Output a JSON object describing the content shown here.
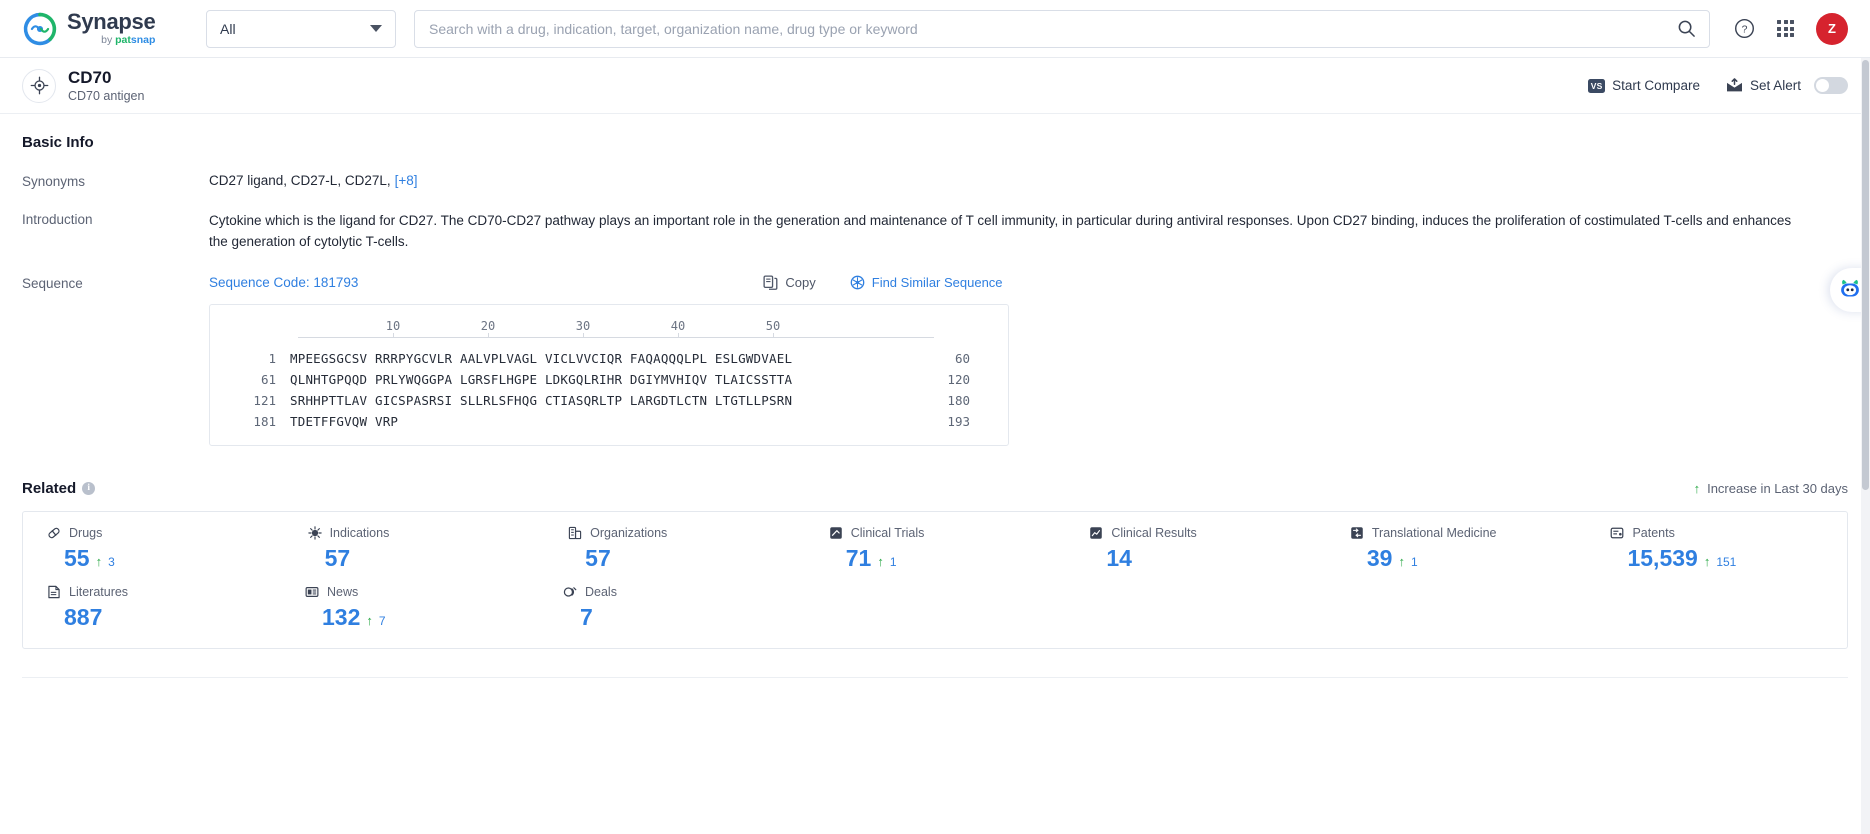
{
  "header": {
    "brand_name": "Synapse",
    "brand_by": "by",
    "brand_pat": "pat",
    "brand_snap": "snap",
    "category_select": "All",
    "search_placeholder": "Search with a drug, indication, target, organization name, drug type or keyword",
    "help_icon": "question-mark-circle-icon",
    "apps_icon": "app-grid-icon",
    "avatar_initial": "Z"
  },
  "entity": {
    "name": "CD70",
    "subtitle": "CD70 antigen",
    "start_compare": "Start Compare",
    "compare_badge": "VS",
    "set_alert": "Set Alert",
    "alert_toggle_state": "off"
  },
  "basic_info": {
    "title": "Basic Info",
    "synonyms_label": "Synonyms",
    "synonyms_value": "CD27 ligand,  CD27-L,  CD27L,",
    "synonyms_more": "[+8]",
    "introduction_label": "Introduction",
    "introduction_value": "Cytokine which is the ligand for CD27. The CD70-CD27 pathway plays an important role in the generation and maintenance of T cell immunity, in particular during antiviral responses. Upon CD27 binding, induces the proliferation of costimulated T-cells and enhances the generation of cytolytic T-cells.",
    "sequence_label": "Sequence",
    "sequence_code": "Sequence Code: 181793",
    "copy_label": "Copy",
    "find_similar_label": "Find Similar Sequence"
  },
  "sequence": {
    "ruler": [
      "10",
      "20",
      "30",
      "40",
      "50"
    ],
    "lines": [
      {
        "start": "1",
        "residues": "MPEEGSGCSV RRRPYGCVLR AALVPLVAGL VICLVVCIQR FAQAQQQLPL ESLGWDVAEL",
        "end": "60"
      },
      {
        "start": "61",
        "residues": "QLNHTGPQQD PRLYWQGGPA LGRSFLHGPE LDKGQLRIHR DGIYMVHIQV TLAICSSTTA",
        "end": "120"
      },
      {
        "start": "121",
        "residues": "SRHHPTTLAV GICSPASRSI SLLRLSFHQG CTIASQRLTP LARGDTLCTN LTGTLLPSRN",
        "end": "180"
      },
      {
        "start": "181",
        "residues": "TDETFFGVQW VRP",
        "end": "193"
      }
    ]
  },
  "related": {
    "title": "Related",
    "increase_note": "Increase in Last 30 days",
    "row1": [
      {
        "icon": "pill-icon",
        "label": "Drugs",
        "value": "55",
        "delta": "3"
      },
      {
        "icon": "virus-icon",
        "label": "Indications",
        "value": "57",
        "delta": ""
      },
      {
        "icon": "building-icon",
        "label": "Organizations",
        "value": "57",
        "delta": ""
      },
      {
        "icon": "clinical-trial-icon",
        "label": "Clinical Trials",
        "value": "71",
        "delta": "1"
      },
      {
        "icon": "clinical-result-icon",
        "label": "Clinical Results",
        "value": "14",
        "delta": ""
      },
      {
        "icon": "translational-icon",
        "label": "Translational Medicine",
        "value": "39",
        "delta": "1"
      },
      {
        "icon": "patent-icon",
        "label": "Patents",
        "value": "15,539",
        "delta": "151"
      }
    ],
    "row2": [
      {
        "icon": "literature-icon",
        "label": "Literatures",
        "value": "887",
        "delta": ""
      },
      {
        "icon": "news-icon",
        "label": "News",
        "value": "132",
        "delta": "7"
      },
      {
        "icon": "deal-icon",
        "label": "Deals",
        "value": "7",
        "delta": ""
      }
    ]
  },
  "assistant": {
    "icon": "robot-assistant-icon"
  },
  "colors": {
    "accent_blue": "#2f7fe0",
    "increase_green": "#2faa4a",
    "avatar_red": "#d6232e",
    "text_dark": "#15192a"
  }
}
